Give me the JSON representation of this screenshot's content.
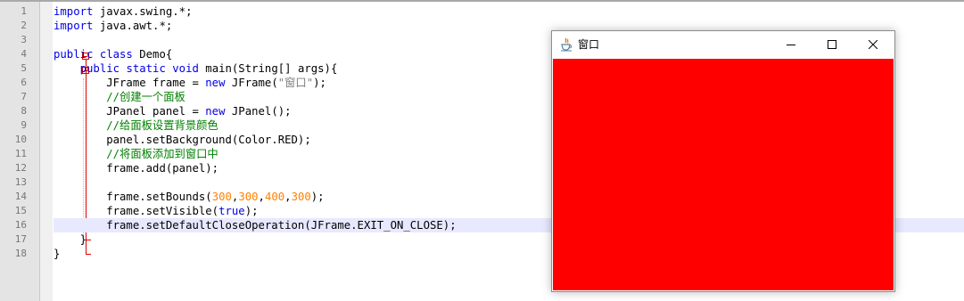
{
  "editor": {
    "line_numbers": [
      "1",
      "2",
      "3",
      "4",
      "5",
      "6",
      "7",
      "8",
      "9",
      "10",
      "11",
      "12",
      "13",
      "14",
      "15",
      "16",
      "17",
      "18"
    ],
    "lines": [
      [
        {
          "t": "import",
          "c": "kw"
        },
        {
          "t": " javax.swing.*;",
          "c": ""
        }
      ],
      [
        {
          "t": "import",
          "c": "kw"
        },
        {
          "t": " java.awt.*;",
          "c": ""
        }
      ],
      [],
      [
        {
          "t": "public class",
          "c": "kw"
        },
        {
          "t": " Demo{",
          "c": ""
        }
      ],
      [
        {
          "t": "    ",
          "c": ""
        },
        {
          "t": "public static void",
          "c": "kw"
        },
        {
          "t": " main(String[] args){",
          "c": ""
        }
      ],
      [
        {
          "t": "        JFrame frame = ",
          "c": ""
        },
        {
          "t": "new",
          "c": "kw"
        },
        {
          "t": " JFrame(",
          "c": ""
        },
        {
          "t": "\"窗口\"",
          "c": "str"
        },
        {
          "t": ");",
          "c": ""
        }
      ],
      [
        {
          "t": "        ",
          "c": ""
        },
        {
          "t": "//创建一个面板",
          "c": "cm"
        }
      ],
      [
        {
          "t": "        JPanel panel = ",
          "c": ""
        },
        {
          "t": "new",
          "c": "kw"
        },
        {
          "t": " JPanel();",
          "c": ""
        }
      ],
      [
        {
          "t": "        ",
          "c": ""
        },
        {
          "t": "//给面板设置背景颜色",
          "c": "cm"
        }
      ],
      [
        {
          "t": "        panel.setBackground(Color.RED);",
          "c": ""
        }
      ],
      [
        {
          "t": "        ",
          "c": ""
        },
        {
          "t": "//将面板添加到窗口中",
          "c": "cm"
        }
      ],
      [
        {
          "t": "        frame.add(panel);",
          "c": ""
        }
      ],
      [],
      [
        {
          "t": "        frame.setBounds(",
          "c": ""
        },
        {
          "t": "300",
          "c": "num"
        },
        {
          "t": ",",
          "c": ""
        },
        {
          "t": "300",
          "c": "num"
        },
        {
          "t": ",",
          "c": ""
        },
        {
          "t": "400",
          "c": "num"
        },
        {
          "t": ",",
          "c": ""
        },
        {
          "t": "300",
          "c": "num"
        },
        {
          "t": ");",
          "c": ""
        }
      ],
      [
        {
          "t": "        frame.setVisible(",
          "c": ""
        },
        {
          "t": "true",
          "c": "kw"
        },
        {
          "t": ");",
          "c": ""
        }
      ],
      [
        {
          "t": "        frame.setDefaultCloseOperation(JFrame.EXIT_ON_CLOSE);",
          "c": ""
        }
      ],
      [
        {
          "t": "    }",
          "c": ""
        }
      ],
      [
        {
          "t": "}",
          "c": ""
        }
      ]
    ],
    "current_line": 16
  },
  "window": {
    "title": "窗口",
    "panel_color": "#ff0000",
    "icons": [
      "java-cup-icon",
      "minimize-icon",
      "maximize-icon",
      "close-icon"
    ]
  },
  "colors": {
    "keyword": "#0000e6",
    "number": "#ff8000",
    "string": "#808080",
    "comment": "#008000",
    "fold_marker": "#e00000",
    "current_line_bg": "#e8e8ff"
  }
}
